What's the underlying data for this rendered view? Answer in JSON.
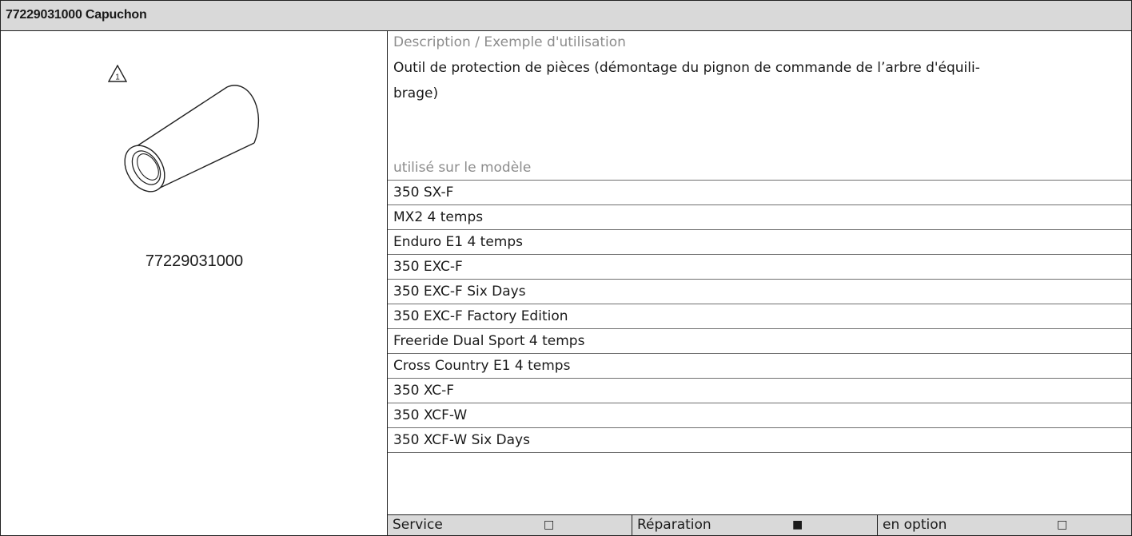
{
  "header": {
    "title": "77229031000 Capuchon"
  },
  "left": {
    "part_number": "77229031000",
    "warning_number": "1"
  },
  "description": {
    "label": "Description / Exemple d'utilisation",
    "line1": "Outil de protection de pièces (démontage du pignon de commande de l’arbre d'équili-",
    "line2": "brage)"
  },
  "models": {
    "label": "utilisé sur le modèle",
    "items": [
      "350 SX-F",
      "MX2 4 temps",
      "Enduro E1 4 temps",
      "350 EXC-F",
      "350 EXC-F Six Days",
      "350 EXC-F Factory Edition",
      "Freeride Dual Sport 4 temps",
      "Cross Country E1 4 temps",
      "350 XC-F",
      "350 XCF-W",
      "350 XCF-W Six Days"
    ]
  },
  "footer": {
    "service": {
      "label": "Service",
      "mark": "□"
    },
    "repair": {
      "label": "Réparation",
      "mark": "■"
    },
    "option": {
      "label": "en option",
      "mark": "□"
    }
  }
}
